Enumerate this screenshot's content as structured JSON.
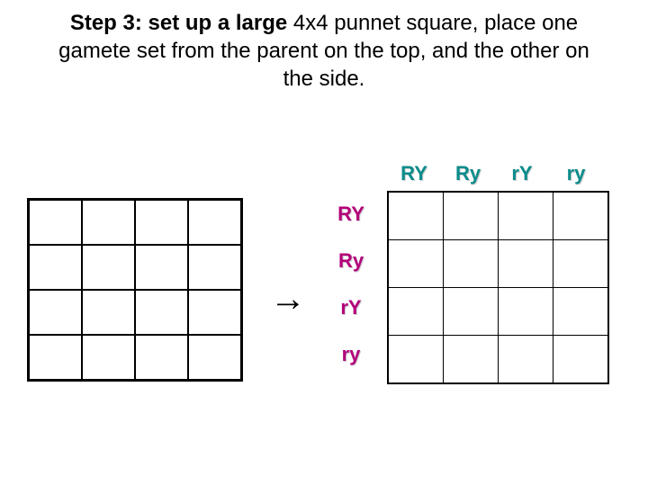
{
  "heading": {
    "bold": "Step 3: set up a large ",
    "rest": "4x4 punnet square, place one gamete set from the parent on the top, and the other on the side."
  },
  "arrow": "→",
  "top_gametes": [
    "RY",
    "Ry",
    "rY",
    "ry"
  ],
  "side_gametes": [
    "RY",
    "Ry",
    "rY",
    "ry"
  ],
  "chart_data": {
    "type": "table",
    "title": "Dihybrid Punnett Square setup (4x4)",
    "columns": [
      "RY",
      "Ry",
      "rY",
      "ry"
    ],
    "rows": [
      "RY",
      "Ry",
      "rY",
      "ry"
    ],
    "cells": [
      [
        "",
        "",
        "",
        ""
      ],
      [
        "",
        "",
        "",
        ""
      ],
      [
        "",
        "",
        "",
        ""
      ],
      [
        "",
        "",
        "",
        ""
      ]
    ]
  }
}
